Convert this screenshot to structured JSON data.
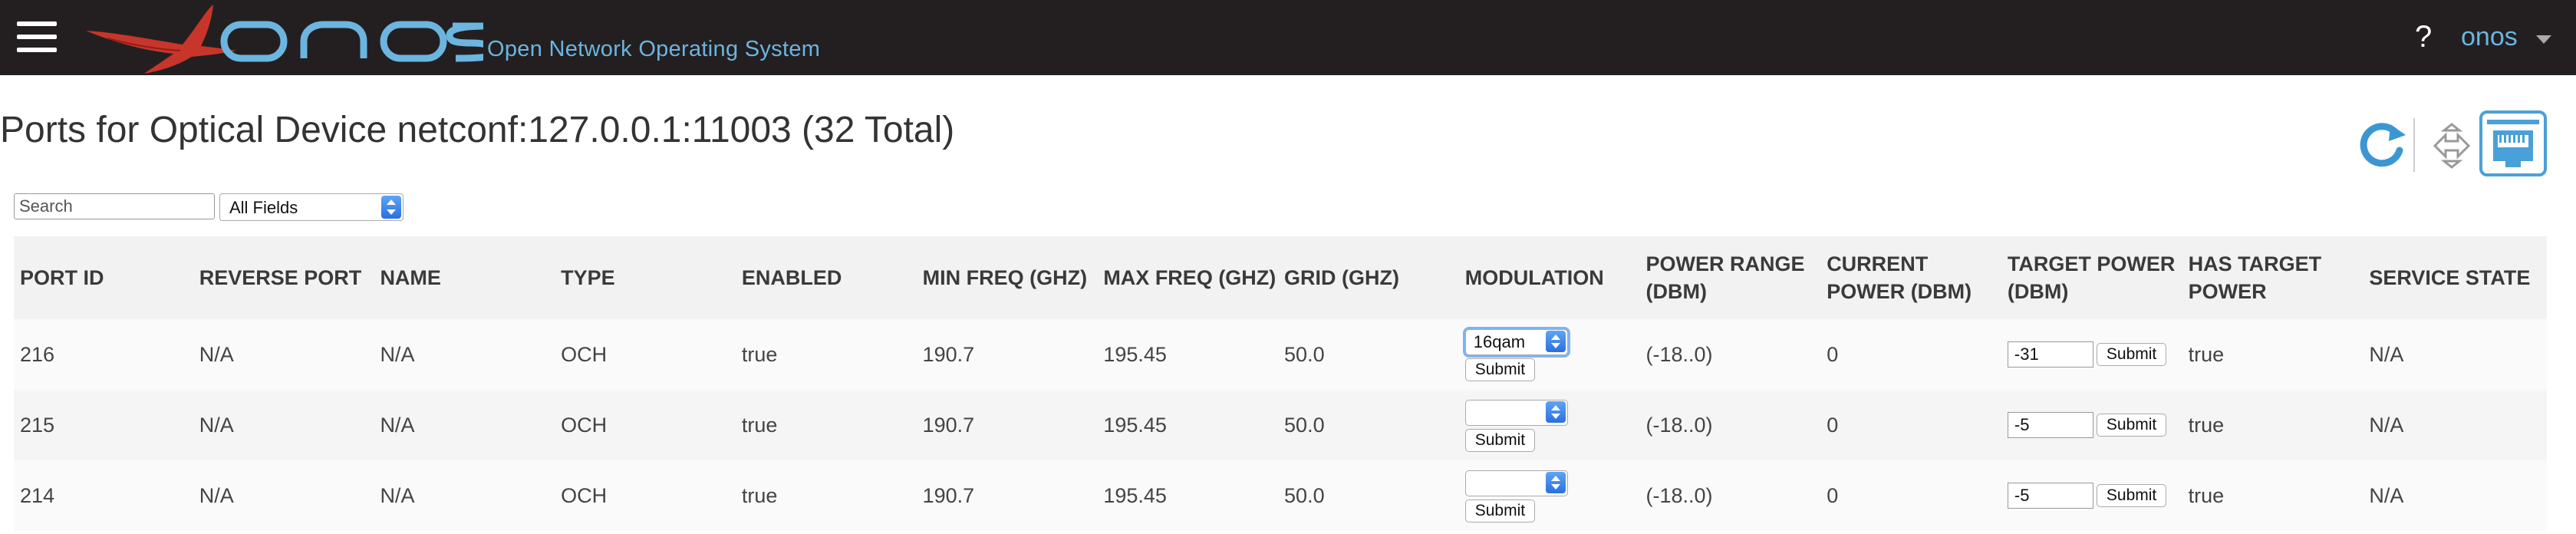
{
  "masthead": {
    "logo_text": "onos",
    "subtitle": "Open Network Operating System",
    "help_label": "?",
    "user_label": "onos"
  },
  "page": {
    "title": "Ports for Optical Device netconf:127.0.0.1:11003 (32 Total)"
  },
  "search": {
    "placeholder": "Search",
    "field_value": "All Fields"
  },
  "table": {
    "headers": [
      "PORT ID",
      "REVERSE PORT",
      "NAME",
      "TYPE",
      "ENABLED",
      "MIN FREQ (GHZ)",
      "MAX FREQ (GHZ)",
      "GRID (GHZ)",
      "MODULATION",
      "POWER RANGE (DBM)",
      "CURRENT POWER (DBM)",
      "TARGET POWER (DBM)",
      "HAS TARGET POWER",
      "SERVICE STATE"
    ],
    "submit_label": "Submit",
    "rows": [
      {
        "port_id": "216",
        "reverse_port": "N/A",
        "name": "N/A",
        "type": "OCH",
        "enabled": "true",
        "min_freq": "190.7",
        "max_freq": "195.45",
        "grid": "50.0",
        "modulation": "16qam",
        "power_range": "(-18..0)",
        "current_power": "0",
        "target_power": "-31",
        "has_target_power": "true",
        "service_state": "N/A"
      },
      {
        "port_id": "215",
        "reverse_port": "N/A",
        "name": "N/A",
        "type": "OCH",
        "enabled": "true",
        "min_freq": "190.7",
        "max_freq": "195.45",
        "grid": "50.0",
        "modulation": "",
        "power_range": "(-18..0)",
        "current_power": "0",
        "target_power": "-5",
        "has_target_power": "true",
        "service_state": "N/A"
      },
      {
        "port_id": "214",
        "reverse_port": "N/A",
        "name": "N/A",
        "type": "OCH",
        "enabled": "true",
        "min_freq": "190.7",
        "max_freq": "195.45",
        "grid": "50.0",
        "modulation": "",
        "power_range": "(-18..0)",
        "current_power": "0",
        "target_power": "-5",
        "has_target_power": "true",
        "service_state": "N/A"
      }
    ]
  },
  "colors": {
    "masthead_bg": "#231f20",
    "accent_blue": "#6bb5e0",
    "logo_red": "#c8352a"
  }
}
